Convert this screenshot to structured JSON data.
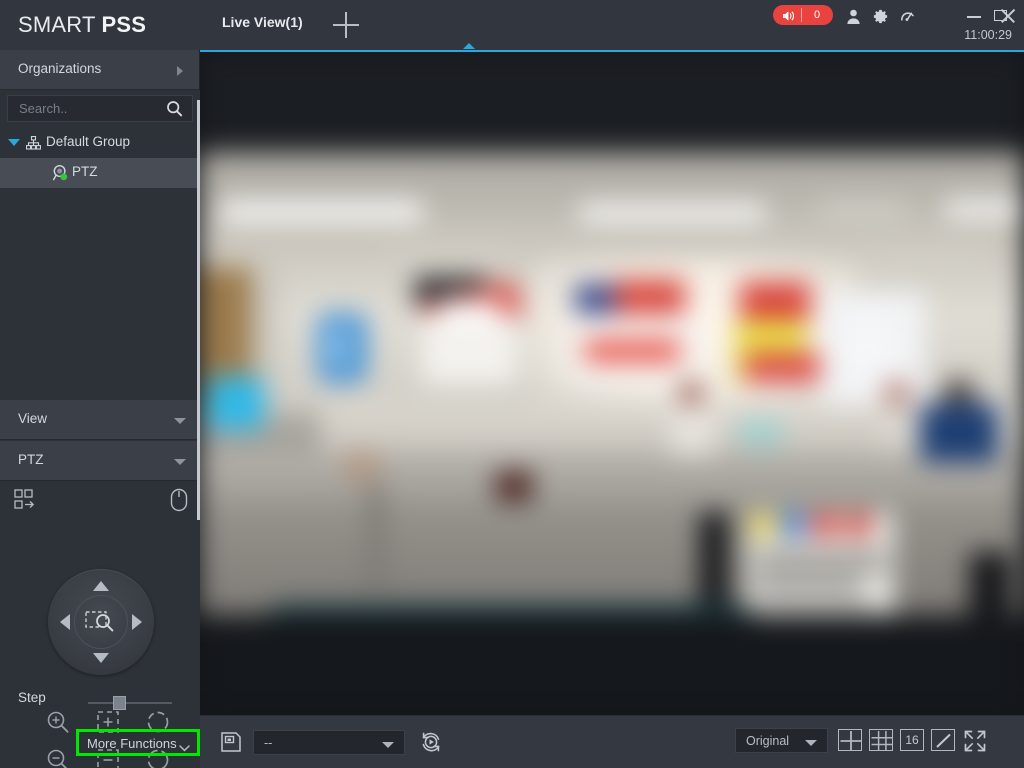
{
  "app": {
    "brand_prefix": "SMART ",
    "brand_suffix": "PSS",
    "clock": "11:00:29",
    "accent_color": "#29a8e0",
    "alarm_color": "#e8433f",
    "highlight_color": "#00e800"
  },
  "titlebar": {
    "tabs": [
      {
        "label": "Live View(1)",
        "active": true
      }
    ],
    "new_tab_label": "+",
    "alarm": {
      "icon": "speaker-icon",
      "count": "0"
    },
    "icons": [
      {
        "name": "user-icon"
      },
      {
        "name": "settings-gear-icon"
      },
      {
        "name": "dashboard-gauge-icon"
      }
    ],
    "window_controls": [
      {
        "name": "minimize-button"
      },
      {
        "name": "maximize-button"
      },
      {
        "name": "close-button"
      }
    ]
  },
  "sidebar": {
    "organizations": {
      "label": "Organizations",
      "caret": "caret-right-icon"
    },
    "search": {
      "value": "",
      "placeholder": "Search.."
    },
    "tree": [
      {
        "label": "Default Group",
        "type": "group",
        "expanded": true,
        "icon": "group-node-icon"
      },
      {
        "label": "PTZ",
        "type": "device",
        "selected": true,
        "icon": "camera-icon",
        "status": "online"
      }
    ],
    "panels": [
      {
        "label": "View",
        "collapsed": true
      },
      {
        "label": "PTZ",
        "collapsed": false
      }
    ],
    "ptz": {
      "pattern_icon": "ptz-pattern-icon",
      "mouse_icon": "ptz-mouse-control-icon",
      "directions": [
        "up",
        "left",
        "right",
        "down"
      ],
      "center_icon": "area-zoom-icon",
      "step_label": "Step",
      "step_value": 35,
      "buttons": [
        {
          "name": "zoom-in-button",
          "icon": "magnifier-plus-icon"
        },
        {
          "name": "focus-near-button",
          "icon": "focus-plus-icon"
        },
        {
          "name": "iris-open-button",
          "icon": "iris-open-icon"
        },
        {
          "name": "zoom-out-button",
          "icon": "magnifier-minus-icon"
        },
        {
          "name": "focus-far-button",
          "icon": "focus-minus-icon"
        },
        {
          "name": "iris-close-button",
          "icon": "iris-close-icon"
        }
      ],
      "more_functions": {
        "label": "More Functions",
        "caret": "chevron-down-icon",
        "highlighted": true
      }
    }
  },
  "main": {
    "video": {
      "description": "Blurred live camera view of an indoor office / reception area with ceiling fluorescent lights, wall posters, service counters and seating."
    },
    "bottombar": {
      "left": {
        "save_preset_icon": "save-view-icon",
        "preset_select": {
          "value": "--",
          "caret": "chevron-down-icon"
        },
        "tour_icon": "refresh-play-icon"
      },
      "right": {
        "ratio_select": {
          "value": "Original",
          "caret": "chevron-down-icon"
        },
        "layout_buttons": [
          {
            "name": "layout-4-button",
            "label": "",
            "icon": "grid-4-icon"
          },
          {
            "name": "layout-9-button",
            "label": "",
            "icon": "grid-9-icon"
          },
          {
            "name": "layout-16-button",
            "label": "16",
            "icon": "grid-16-icon"
          },
          {
            "name": "custom-layout-button",
            "label": "",
            "icon": "pencil-icon"
          }
        ],
        "fullscreen_icon": "fullscreen-expand-icon"
      }
    }
  }
}
